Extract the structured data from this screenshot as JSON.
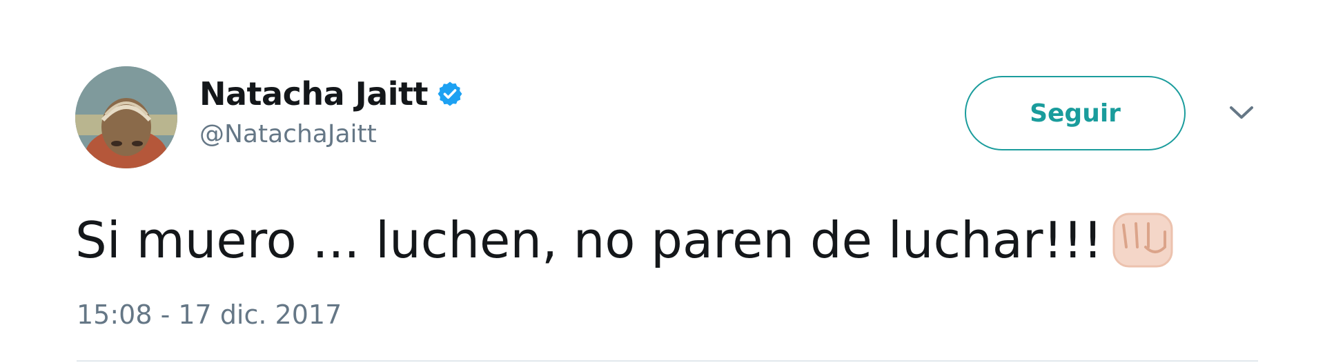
{
  "author": {
    "name": "Natacha Jaitt",
    "handle": "@NatachaJaitt",
    "verified": true
  },
  "actions": {
    "follow_label": "Seguir"
  },
  "tweet": {
    "text": "Si muero ... luchen, no paren de luchar!!!",
    "emoji": "fist-icon",
    "timestamp": "15:08 - 17 dic. 2017"
  },
  "colors": {
    "accent": "#1a9c9c",
    "verified": "#1da1f2",
    "text": "#14171a",
    "muted": "#657786",
    "divider": "#e1e8ed"
  }
}
